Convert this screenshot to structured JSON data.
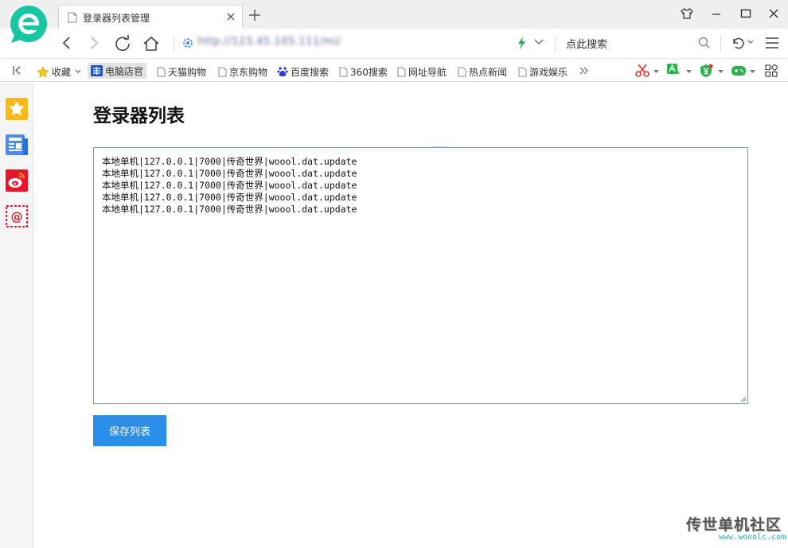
{
  "browser": {
    "tab_title": "登录器列表管理",
    "url": "http://123.45.105.111/mi/",
    "search_placeholder": "点此搜索"
  },
  "bookmarks": [
    {
      "label": "收藏"
    },
    {
      "label": "电脑店官"
    },
    {
      "label": "天猫购物"
    },
    {
      "label": "京东购物"
    },
    {
      "label": "百度搜索"
    },
    {
      "label": "360搜索"
    },
    {
      "label": "网址导航"
    },
    {
      "label": "热点新闻"
    },
    {
      "label": "游戏娱乐"
    }
  ],
  "page": {
    "title": "登录器列表",
    "list_text": "本地单机|127.0.0.1|7000|传奇世界|woool.dat.update\n本地单机|127.0.0.1|7000|传奇世界|woool.dat.update\n本地单机|127.0.0.1|7000|传奇世界|woool.dat.update\n本地单机|127.0.0.1|7000|传奇世界|woool.dat.update\n本地单机|127.0.0.1|7000|传奇世界|woool.dat.update",
    "save_label": "保存列表"
  },
  "watermark": {
    "main": "传世单机社区",
    "sub": "www.wooolc.com"
  },
  "colors": {
    "accent": "#2b8ee8",
    "textarea_border": "#6b9be4"
  }
}
